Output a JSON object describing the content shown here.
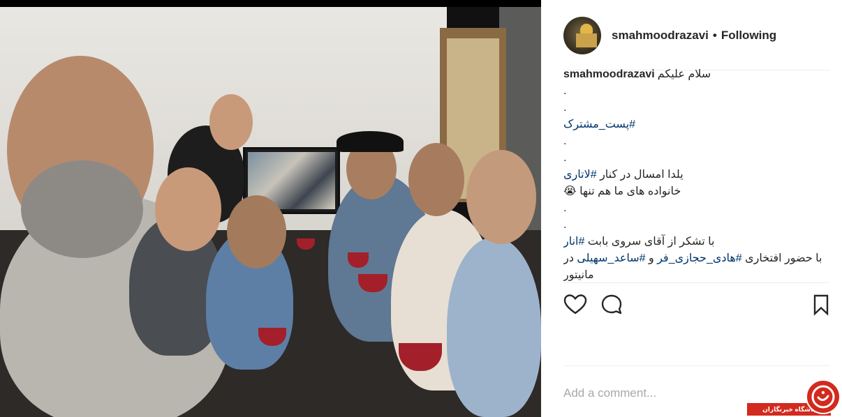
{
  "post": {
    "username": "smahmoodrazavi",
    "separator": "•",
    "follow_status": "Following",
    "photo_alt": ""
  },
  "caption": {
    "username": "smahmoodrazavi",
    "line1_text": "سلام علیکم",
    "dot": ".",
    "tag_post_moshtarak": "#پست_مشترک",
    "line_yalda": "یلدا امسال در کنار",
    "tag_latari": "#لاتاری",
    "line_families": "خانواده های ما هم تنها",
    "emoji": "😭",
    "line_thanks": "با تشکر از آقای سروی بابت",
    "tag_anar": "#انار",
    "line_presence_pre": "با حضور افتخاری",
    "tag_hadi": "#هادی_حجازی_فر",
    "line_presence_and": "و",
    "tag_saeed": "#ساعد_سهیلی",
    "line_presence_post": "در",
    "line_monitor": "مانیتور"
  },
  "actions": {
    "like_icon": "heart-outline-icon",
    "comment_icon": "comment-bubble-icon",
    "save_icon": "bookmark-outline-icon"
  },
  "comment_box": {
    "placeholder": "Add a comment..."
  },
  "watermark": {
    "text": "باشگاه خبرنگاران",
    "color": "#d22a1e"
  },
  "colors": {
    "text": "#262626",
    "hashtag": "#003569",
    "divider": "#efefef",
    "placeholder": "#a8a8a8"
  }
}
